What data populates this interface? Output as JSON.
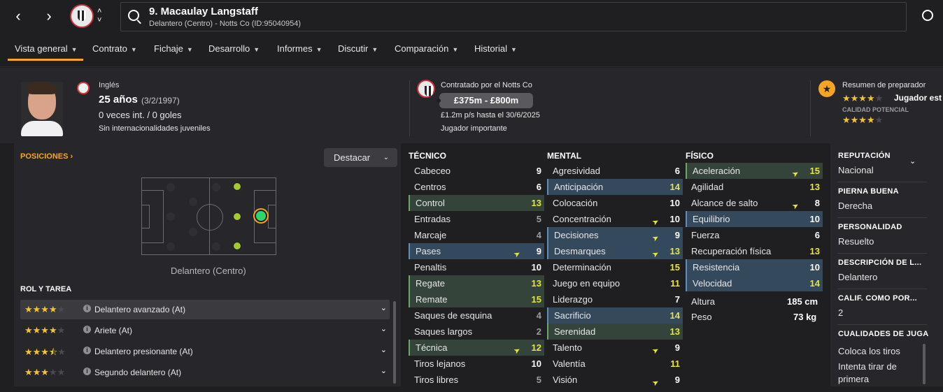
{
  "header": {
    "title": "9. Macaulay Langstaff",
    "subtitle": "Delantero (Centro) - Notts Co (ID:95040954)"
  },
  "menu": [
    {
      "label": "Vista general"
    },
    {
      "label": "Contrato"
    },
    {
      "label": "Fichaje"
    },
    {
      "label": "Desarrollo"
    },
    {
      "label": "Informes"
    },
    {
      "label": "Discutir"
    },
    {
      "label": "Comparación"
    },
    {
      "label": "Historial"
    }
  ],
  "profile": {
    "nationality": "Inglés",
    "age": "25 años",
    "dob": "(3/2/1997)",
    "caps": "0 veces int. / 0 goles",
    "youth": "Sin internacionalidades juveniles"
  },
  "contract": {
    "club_line": "Contratado por el Notts Co",
    "value": "£375m - £800m",
    "wage": "£1.2m p/s hasta el 30/6/2025",
    "status": "Jugador importante"
  },
  "coach": {
    "title": "Resumen de preparador",
    "current_label": "Jugador est",
    "current_stars": 3.5,
    "potential_label": "CALIDAD POTENCIAL",
    "potential_stars": 3.5
  },
  "positions": {
    "title": "POSICIONES",
    "highlight_button": "Destacar",
    "position_label": "Delantero (Centro)"
  },
  "roles": {
    "title": "ROL Y TAREA",
    "items": [
      {
        "label": "Delantero avanzado (At)",
        "stars": 4
      },
      {
        "label": "Ariete (At)",
        "stars": 4
      },
      {
        "label": "Delantero presionante (At)",
        "stars": 3.5
      },
      {
        "label": "Segundo delantero (At)",
        "stars": 3
      }
    ]
  },
  "technical": {
    "title": "TÉCNICO",
    "attrs": [
      {
        "name": "Cabeceo",
        "value": "9"
      },
      {
        "name": "Centros",
        "value": "6"
      },
      {
        "name": "Control",
        "value": "13"
      },
      {
        "name": "Entradas",
        "value": "5"
      },
      {
        "name": "Marcaje",
        "value": "4"
      },
      {
        "name": "Pases",
        "value": "9"
      },
      {
        "name": "Penaltis",
        "value": "10"
      },
      {
        "name": "Regate",
        "value": "13"
      },
      {
        "name": "Remate",
        "value": "15"
      },
      {
        "name": "Saques de esquina",
        "value": "4"
      },
      {
        "name": "Saques largos",
        "value": "2"
      },
      {
        "name": "Técnica",
        "value": "12"
      },
      {
        "name": "Tiros lejanos",
        "value": "10"
      },
      {
        "name": "Tiros libres",
        "value": "5"
      }
    ]
  },
  "mental": {
    "title": "MENTAL",
    "attrs": [
      {
        "name": "Agresividad",
        "value": "6"
      },
      {
        "name": "Anticipación",
        "value": "14"
      },
      {
        "name": "Colocación",
        "value": "10"
      },
      {
        "name": "Concentración",
        "value": "10"
      },
      {
        "name": "Decisiones",
        "value": "9"
      },
      {
        "name": "Desmarques",
        "value": "13"
      },
      {
        "name": "Determinación",
        "value": "15"
      },
      {
        "name": "Juego en equipo",
        "value": "11"
      },
      {
        "name": "Liderazgo",
        "value": "7"
      },
      {
        "name": "Sacrificio",
        "value": "14"
      },
      {
        "name": "Serenidad",
        "value": "13"
      },
      {
        "name": "Talento",
        "value": "9"
      },
      {
        "name": "Valentía",
        "value": "11"
      },
      {
        "name": "Visión",
        "value": "9"
      }
    ]
  },
  "physical": {
    "title": "FÍSICO",
    "attrs": [
      {
        "name": "Aceleración",
        "value": "15"
      },
      {
        "name": "Agilidad",
        "value": "13"
      },
      {
        "name": "Alcance de salto",
        "value": "8"
      },
      {
        "name": "Equilibrio",
        "value": "10"
      },
      {
        "name": "Fuerza",
        "value": "6"
      },
      {
        "name": "Recuperación física",
        "value": "13"
      },
      {
        "name": "Resistencia",
        "value": "10"
      },
      {
        "name": "Velocidad",
        "value": "14"
      }
    ],
    "height_label": "Altura",
    "height": "185 cm",
    "weight_label": "Peso",
    "weight": "73 kg"
  },
  "info": {
    "reputation_label": "REPUTACIÓN",
    "reputation": "Nacional",
    "foot_label": "PIERNA BUENA",
    "foot": "Derecha",
    "personality_label": "PERSONALIDAD",
    "personality": "Resuelto",
    "media_label": "DESCRIPCIÓN DE L...",
    "media": "Delantero",
    "gk_label": "CALIF. COMO POR...",
    "gk": "2",
    "traits_label": "CUALIDADES DE JUGA",
    "traits": [
      "Coloca los tiros",
      "Intenta tirar de",
      "primera"
    ]
  },
  "colors": {
    "accent": "#f4a623",
    "highlight_value": "#e6e53c",
    "row_blue": "#34495c",
    "row_green": "#35443a",
    "background": "#1f1f22"
  },
  "icons": [
    "back-arrow-icon",
    "forward-arrow-icon",
    "club-crest-icon",
    "search-icon",
    "globe-icon",
    "star-badge-icon",
    "info-icon",
    "chevron-down-icon",
    "trend-arrow-icon"
  ]
}
